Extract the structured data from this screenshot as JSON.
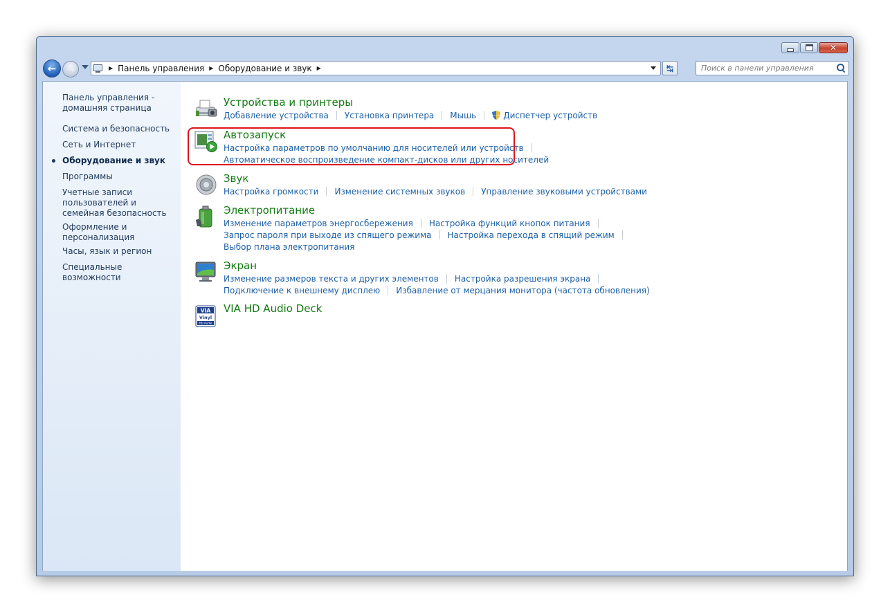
{
  "window": {
    "breadcrumb": [
      "Панель управления",
      "Оборудование и звук"
    ],
    "search_placeholder": "Поиск в панели управления"
  },
  "sidebar": {
    "items": [
      {
        "label": "Панель управления - домашняя страница",
        "current": false
      },
      {
        "label": "Система и безопасность",
        "current": false
      },
      {
        "label": "Сеть и Интернет",
        "current": false
      },
      {
        "label": "Оборудование и звук",
        "current": true
      },
      {
        "label": "Программы",
        "current": false
      },
      {
        "label": "Учетные записи пользователей и семейная безопасность",
        "current": false
      },
      {
        "label": "Оформление и персонализация",
        "current": false
      },
      {
        "label": "Часы, язык и регион",
        "current": false
      },
      {
        "label": "Специальные возможности",
        "current": false
      }
    ]
  },
  "categories": {
    "devices": {
      "title": "Устройства и принтеры",
      "links": [
        "Добавление устройства",
        "Установка принтера",
        "Мышь",
        "Диспетчер устройств"
      ]
    },
    "autoplay": {
      "title": "Автозапуск",
      "links": [
        "Настройка параметров по умолчанию для носителей или устройств",
        "Автоматическое воспроизведение компакт-дисков или других носителей"
      ]
    },
    "sound": {
      "title": "Звук",
      "links": [
        "Настройка громкости",
        "Изменение системных звуков",
        "Управление звуковыми устройствами"
      ]
    },
    "power": {
      "title": "Электропитание",
      "links": [
        "Изменение параметров энергосбережения",
        "Настройка функций кнопок питания",
        "Запрос пароля при выходе из спящего режима",
        "Настройка перехода в спящий режим",
        "Выбор плана электропитания"
      ]
    },
    "display": {
      "title": "Экран",
      "links": [
        "Изменение размеров текста и других элементов",
        "Настройка разрешения экрана",
        "Подключение к внешнему дисплею",
        "Избавление от мерцания монитора (частота обновления)"
      ]
    },
    "via": {
      "title": "VIA HD Audio Deck",
      "icon_text": [
        "VIA",
        "Vinyl",
        "HD Audio"
      ]
    }
  },
  "colors": {
    "category_title": "#127a12",
    "task_link": "#1c5fa6",
    "highlight": "#e0111c"
  }
}
